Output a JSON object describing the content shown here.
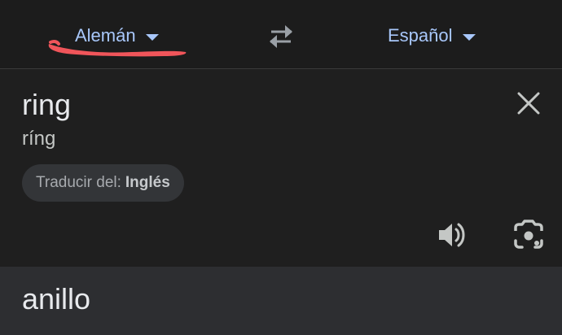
{
  "language_bar": {
    "source_language": "Alemán",
    "target_language": "Español",
    "swap_icon": "swap-horizontal-icon",
    "caret_icon": "caret-down-icon",
    "annotation_color": "#f0555a"
  },
  "input": {
    "text": "ring",
    "transliteration": "ríng",
    "detect_prefix": "Traducir del:",
    "detected_language": "Inglés",
    "clear_icon": "close-icon",
    "speaker_icon": "speaker-icon",
    "lens_icon": "camera-lens-icon"
  },
  "output": {
    "text": "anillo"
  },
  "colors": {
    "accent": "#a8c7fa",
    "background": "#1f1f1f",
    "result_background": "#2d2e31",
    "chip_background": "#333538",
    "text_primary": "#e8eaed"
  }
}
